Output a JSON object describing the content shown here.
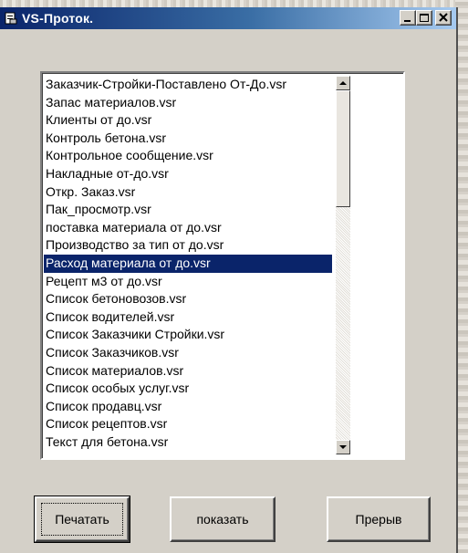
{
  "window": {
    "title": "VS-Проток.",
    "app_icon": "document-icon",
    "controls": [
      "minimize-icon",
      "maximize-icon",
      "close-icon"
    ]
  },
  "file_list": {
    "selected_index": 10,
    "scroll_position": 0.0,
    "items": [
      "Заказчик-Стройки-Поставлено От-До.vsr",
      "Запас материалов.vsr",
      "Клиенты от до.vsr",
      "Контроль бетона.vsr",
      "Контрольное сообщение.vsr",
      "Накладные от-до.vsr",
      "Откр. Заказ.vsr",
      "Пак_просмотр.vsr",
      "поставка материала от до.vsr",
      "Производство за тип от до.vsr",
      "Расход материала от до.vsr",
      "Рецепт м3 от до.vsr",
      "Список бетоновозов.vsr",
      "Список водителей.vsr",
      "Список Заказчики Стройки.vsr",
      "Список Заказчиков.vsr",
      "Список материалов.vsr",
      "Список особых услуг.vsr",
      "Список продавц.vsr",
      "Список рецептов.vsr",
      "Текст для бетона.vsr"
    ]
  },
  "buttons": {
    "print": "Печатать",
    "show": "показать",
    "abort": "Прерыв"
  },
  "colors": {
    "selection": "#0a246a",
    "titlebar_start": "#0a246a",
    "titlebar_end": "#a6caf0",
    "face": "#d4d0c8"
  }
}
